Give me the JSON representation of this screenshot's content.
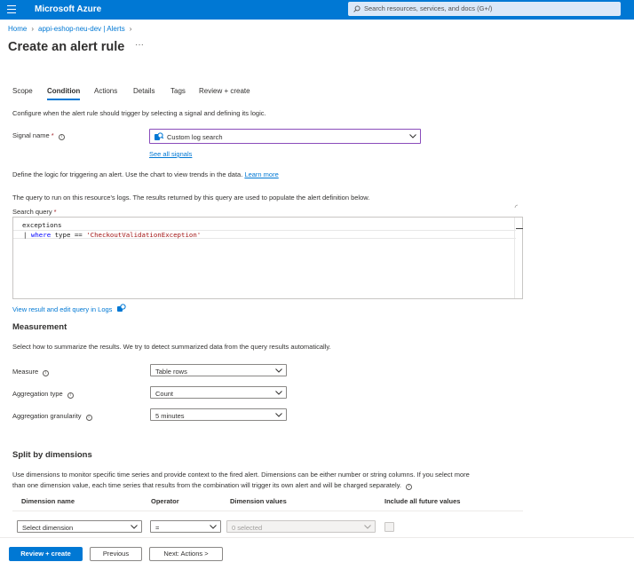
{
  "topbar": {
    "brand": "Microsoft Azure",
    "search_placeholder": "Search resources, services, and docs (G+/)"
  },
  "breadcrumb": [
    "Home",
    "appi-eshop-neu-dev | Alerts"
  ],
  "page": {
    "title": "Create an alert rule",
    "more": "···"
  },
  "tabs": [
    {
      "label": "Scope",
      "active": false
    },
    {
      "label": "Condition",
      "active": true
    },
    {
      "label": "Actions",
      "active": false
    },
    {
      "label": "Details",
      "active": false
    },
    {
      "label": "Tags",
      "active": false
    },
    {
      "label": "Review + create",
      "active": false
    }
  ],
  "condition": {
    "intro": "Configure when the alert rule should trigger by selecting a signal and defining its logic.",
    "signal_label": "Signal name",
    "signal_value": "Custom log search",
    "see_all": "See all signals",
    "logic_text": "Define the logic for triggering an alert. Use the chart to view trends in the data.",
    "learn_more": "Learn more",
    "query_intro": "The query to run on this resource's logs. The results returned by this query are used to populate the alert definition below.",
    "search_query_label": "Search query",
    "query_line1": "exceptions",
    "query_pipe": "|",
    "query_where": "where",
    "query_field": " type == ",
    "query_string": "'CheckoutValidationException'",
    "view_logs": "View result and edit query in Logs"
  },
  "measurement": {
    "heading": "Measurement",
    "intro": "Select how to summarize the results. We try to detect summarized data from the query results automatically.",
    "measure_label": "Measure",
    "measure_value": "Table rows",
    "aggregation_type_label": "Aggregation type",
    "aggregation_type_value": "Count",
    "granularity_label": "Aggregation granularity",
    "granularity_value": "5 minutes"
  },
  "split": {
    "heading": "Split by dimensions",
    "intro1": "Use dimensions to monitor specific time series and provide context to the fired alert. Dimensions can be either number or string columns. If you select more",
    "intro2": "than one dimension value, each time series that results from the combination will trigger its own alert and will be charged separately.",
    "columns": [
      "Dimension name",
      "Operator",
      "Dimension values",
      "Include all future values"
    ],
    "dimension_placeholder": "Select dimension",
    "operator_value": "=",
    "values_placeholder": "0 selected"
  },
  "footer": {
    "review_create": "Review + create",
    "previous": "Previous",
    "next": "Next: Actions >"
  },
  "colors": {
    "accent": "#0078d4",
    "signal_border": "#8a4dbb",
    "required": "#a4262c"
  }
}
